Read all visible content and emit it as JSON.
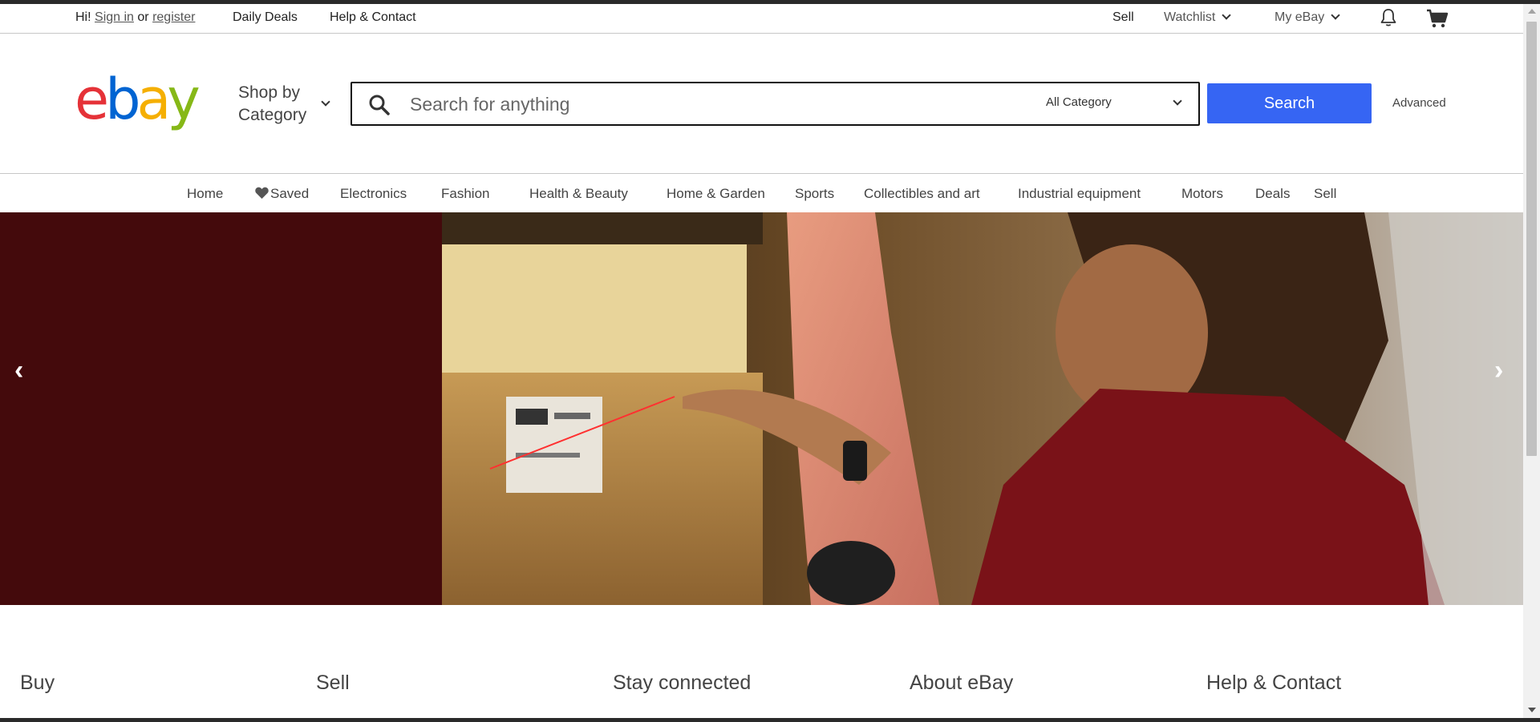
{
  "topbar": {
    "greeting_prefix": "Hi!",
    "sign_in": "Sign in",
    "or": "or",
    "register": "register",
    "daily_deals": "Daily Deals",
    "help_contact": "Help & Contact",
    "sell": "Sell",
    "watchlist": "Watchlist",
    "my_ebay": "My eBay",
    "notifications_icon": "bell-icon",
    "cart_icon": "cart-icon"
  },
  "header": {
    "logo_text": "ebay",
    "logo_colors": [
      "#e53238",
      "#0064d2",
      "#f5af02",
      "#86b817"
    ],
    "shop_by_category_line1": "Shop by",
    "shop_by_category_line2": "Category",
    "search_placeholder": "Search for anything",
    "category_selected": "All Category",
    "search_button": "Search",
    "advanced": "Advanced",
    "accent_color": "#3665f3"
  },
  "nav": {
    "items": [
      "Home",
      "Saved",
      "Electronics",
      "Fashion",
      "Health & Beauty",
      "Home & Garden",
      "Sports",
      "Collectibles and art",
      "Industrial equipment",
      "Motors",
      "Deals",
      "Sell"
    ]
  },
  "hero": {
    "prev_arrow": "‹",
    "next_arrow": "›",
    "background_color": "#440a0c"
  },
  "footer": {
    "columns": [
      "Buy",
      "Sell",
      "Stay connected",
      "About eBay",
      "Help & Contact"
    ]
  }
}
